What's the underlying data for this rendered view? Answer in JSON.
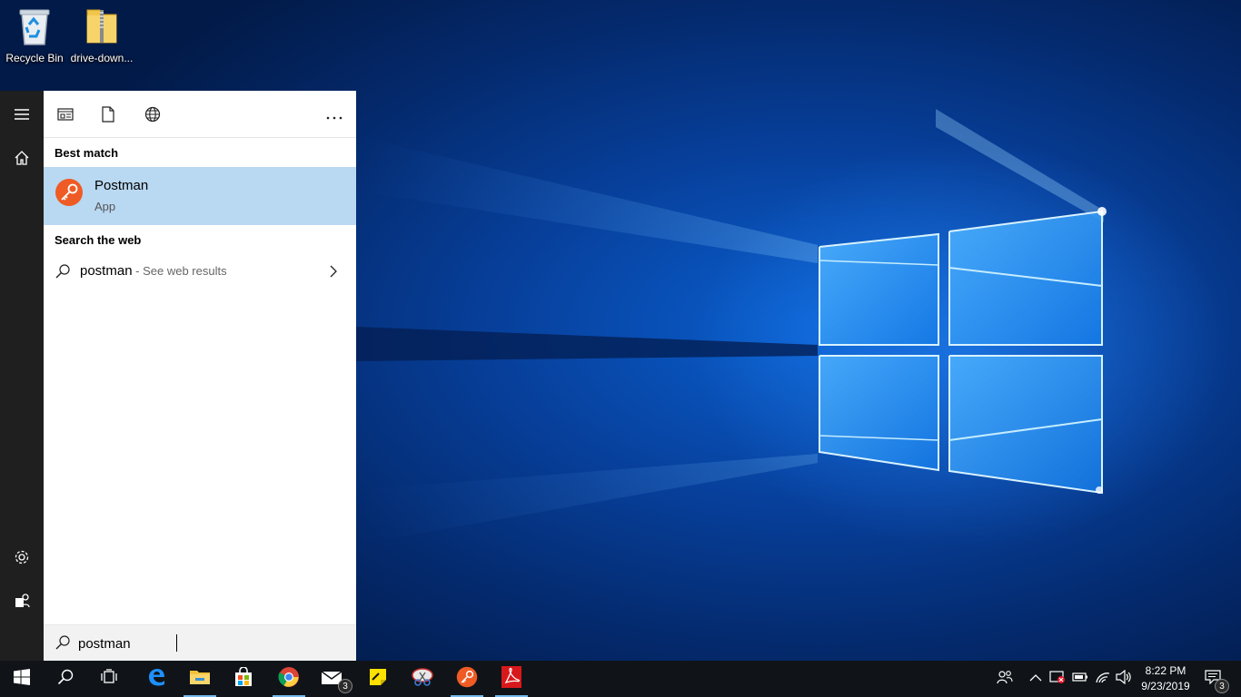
{
  "desktop": {
    "icons": [
      {
        "label": "Recycle Bin",
        "icon": "recycle-bin-icon"
      },
      {
        "label": "drive-down...",
        "icon": "zip-folder-icon"
      }
    ]
  },
  "start_rail": {
    "items": [
      {
        "name": "menu",
        "icon": "hamburger-icon"
      },
      {
        "name": "home",
        "icon": "home-icon"
      },
      {
        "name": "settings",
        "icon": "gear-icon"
      },
      {
        "name": "account",
        "icon": "user-icon"
      }
    ]
  },
  "search": {
    "filter_tabs": [
      {
        "name": "apps",
        "icon": "app-window-icon"
      },
      {
        "name": "documents",
        "icon": "document-icon"
      },
      {
        "name": "web",
        "icon": "globe-icon"
      },
      {
        "name": "more",
        "icon": "ellipsis-icon"
      }
    ],
    "best_match_title": "Best match",
    "best_match": {
      "name": "Postman",
      "type": "App",
      "icon": "postman-icon",
      "accent": "#ef5b25"
    },
    "web_title": "Search the web",
    "web_result": {
      "query": "postman",
      "suffix": " - See web results"
    },
    "query": "postman"
  },
  "taskbar": {
    "pinned": [
      {
        "name": "start",
        "icon": "windows-logo-icon"
      },
      {
        "name": "search",
        "icon": "search-icon"
      },
      {
        "name": "task-view",
        "icon": "task-view-icon"
      },
      {
        "name": "edge",
        "icon": "edge-icon"
      },
      {
        "name": "file-explorer",
        "icon": "folder-icon"
      },
      {
        "name": "store",
        "icon": "store-icon"
      },
      {
        "name": "chrome",
        "icon": "chrome-icon"
      },
      {
        "name": "mail",
        "icon": "mail-icon"
      },
      {
        "name": "sticky-notes",
        "icon": "sticky-notes-icon"
      },
      {
        "name": "snipping",
        "icon": "snipping-icon"
      },
      {
        "name": "postman",
        "icon": "postman-icon"
      },
      {
        "name": "acrobat",
        "icon": "acrobat-icon"
      }
    ],
    "mail_badge": "3",
    "tray": {
      "icons": [
        "people-icon",
        "chevron-up-icon",
        "security-icon",
        "battery-icon",
        "wifi-icon",
        "volume-icon"
      ],
      "time": "8:22 PM",
      "date": "9/23/2019",
      "notification_count": "3"
    },
    "accent_running": "#76b9ed"
  }
}
